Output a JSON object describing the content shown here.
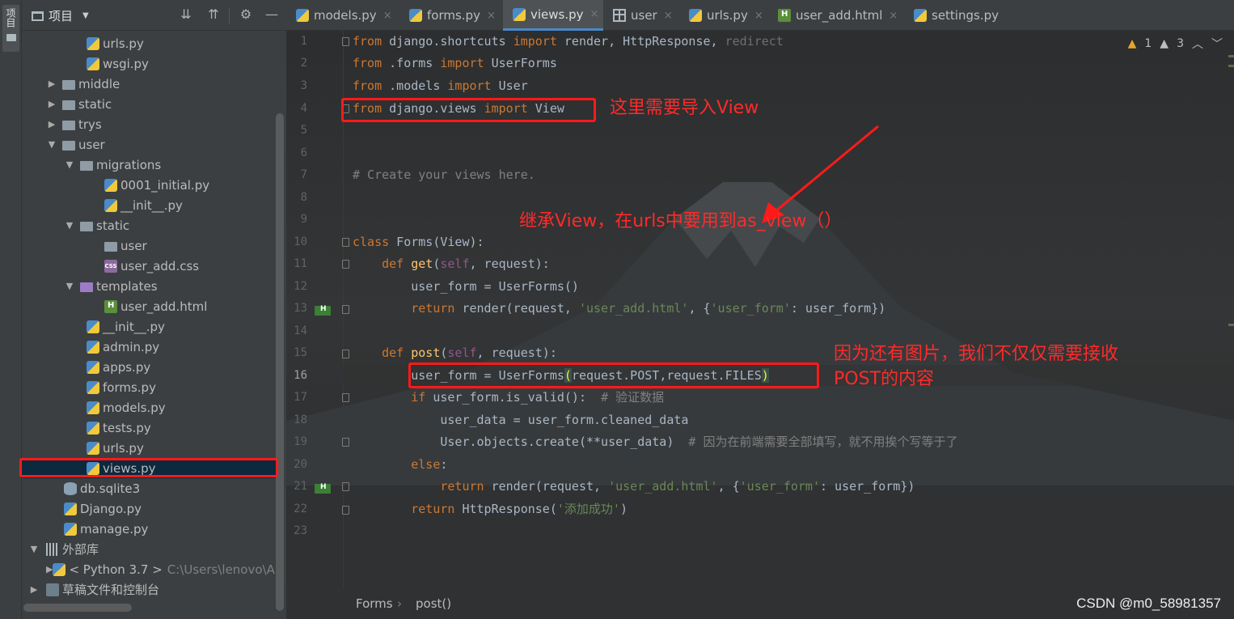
{
  "toolstrip": {
    "project_tab": "项目"
  },
  "project": {
    "title": "项目",
    "tree": [
      {
        "label": "urls.py",
        "icon": "python-file-icon"
      },
      {
        "label": "wsgi.py",
        "icon": "python-file-icon"
      },
      {
        "label": "middle",
        "icon": "folder-icon"
      },
      {
        "label": "static",
        "icon": "folder-icon"
      },
      {
        "label": "trys",
        "icon": "folder-icon"
      },
      {
        "label": "user",
        "icon": "folder-icon"
      },
      {
        "label": "migrations",
        "icon": "folder-icon"
      },
      {
        "label": "0001_initial.py",
        "icon": "python-file-icon"
      },
      {
        "label": "__init__.py",
        "icon": "python-file-icon"
      },
      {
        "label": "static",
        "icon": "folder-icon"
      },
      {
        "label": "user",
        "icon": "folder-icon"
      },
      {
        "label": "user_add.css",
        "icon": "css-file-icon"
      },
      {
        "label": "templates",
        "icon": "folder-icon"
      },
      {
        "label": "user_add.html",
        "icon": "html-file-icon"
      },
      {
        "label": "__init__.py",
        "icon": "python-file-icon"
      },
      {
        "label": "admin.py",
        "icon": "python-file-icon"
      },
      {
        "label": "apps.py",
        "icon": "python-file-icon"
      },
      {
        "label": "forms.py",
        "icon": "python-file-icon"
      },
      {
        "label": "models.py",
        "icon": "python-file-icon"
      },
      {
        "label": "tests.py",
        "icon": "python-file-icon"
      },
      {
        "label": "urls.py",
        "icon": "python-file-icon"
      },
      {
        "label": "views.py",
        "icon": "python-file-icon"
      },
      {
        "label": "db.sqlite3",
        "icon": "database-icon"
      },
      {
        "label": "Django.py",
        "icon": "python-file-icon"
      },
      {
        "label": "manage.py",
        "icon": "python-file-icon"
      },
      {
        "label": "外部库",
        "icon": "library-icon"
      },
      {
        "label": "< Python 3.7 >",
        "icon": "python-file-icon",
        "path": "C:\\Users\\lenovo\\Ap"
      },
      {
        "label": "草稿文件和控制台",
        "icon": "console-icon"
      }
    ]
  },
  "tabs": [
    {
      "label": "models.py"
    },
    {
      "label": "forms.py"
    },
    {
      "label": "views.py"
    },
    {
      "label": "user"
    },
    {
      "label": "urls.py"
    },
    {
      "label": "user_add.html"
    },
    {
      "label": "settings.py"
    }
  ],
  "close_glyph": "×",
  "inspections": {
    "warnings": "1",
    "weak_warnings": "3"
  },
  "line_numbers": [
    "1",
    "2",
    "3",
    "4",
    "5",
    "6",
    "7",
    "8",
    "9",
    "10",
    "11",
    "12",
    "13",
    "14",
    "15",
    "16",
    "17",
    "18",
    "19",
    "20",
    "21",
    "22",
    "23"
  ],
  "code": {
    "l1": {
      "a": "from",
      "b": " django.shortcuts ",
      "c": "import",
      "d": " render, HttpResponse, ",
      "e": "redirect"
    },
    "l2": {
      "a": "from",
      "b": " .forms ",
      "c": "import",
      "d": " UserForms"
    },
    "l3": {
      "a": "from",
      "b": " .models ",
      "c": "import",
      "d": " User"
    },
    "l4": {
      "a": "from",
      "b": " django.views ",
      "c": "import",
      "d": " View"
    },
    "l7": {
      "a": "# Create your views here."
    },
    "l10": {
      "a": "class",
      "b": " Forms(View):"
    },
    "l11": {
      "a": "    def ",
      "b": "get",
      "c": "(",
      "d": "self",
      "e": ", request):"
    },
    "l12": {
      "a": "        user_form = UserForms()"
    },
    "l13": {
      "a": "        return",
      "b": " render(request, ",
      "c": "'user_add.html'",
      "d": ", {",
      "e": "'user_form'",
      "f": ": user_form})"
    },
    "l15": {
      "a": "    def ",
      "b": "post",
      "c": "(",
      "d": "self",
      "e": ", request):"
    },
    "l16": {
      "a": "        user_form = UserForms",
      "b": "(",
      "c": "request.POST",
      "d": ",",
      "e": "request.FILES",
      "f": ")"
    },
    "l17": {
      "a": "        if",
      "b": " user_form.is_valid():  ",
      "c": "# 验证数据"
    },
    "l18": {
      "a": "            user_data = user_form.cleaned_data"
    },
    "l19": {
      "a": "            User.objects.create(**user_data)  ",
      "b": "# 因为在前端需要全部填写，就不用挨个写等于了"
    },
    "l20": {
      "a": "        else",
      "b": ":"
    },
    "l21": {
      "a": "            return",
      "b": " render(request, ",
      "c": "'user_add.html'",
      "d": ", {",
      "e": "'user_form'",
      "f": ": user_form})"
    },
    "l22": {
      "a": "        return",
      "b": " HttpResponse(",
      "c": "'添加成功'",
      "d": ")"
    }
  },
  "breadcrumb": {
    "class_name": "Forms",
    "separator": "›",
    "method": "post()"
  },
  "annotations": {
    "import_note": "这里需要导入View",
    "inherit_note": "继承View，在urls中要用到as_view（）",
    "files_note_1": "因为还有图片，我们不仅仅需要接收",
    "files_note_2": "POST的内容"
  },
  "watermark": "CSDN @m0_58981357",
  "colors": {
    "annotation_red": "#ff1a1a",
    "keyword": "#cc7832",
    "string": "#6a8759",
    "function": "#ffc66d",
    "comment": "#808080"
  }
}
